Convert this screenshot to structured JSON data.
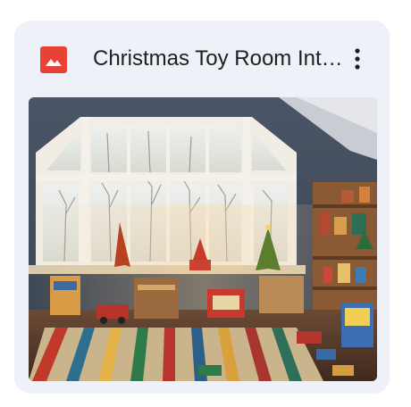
{
  "file": {
    "title": "Christmas Toy Room Interior.jpg",
    "type_icon": "image-file-icon",
    "type_icon_color": "#e94235"
  },
  "menu": {
    "icon": "more-vertical-icon"
  },
  "thumbnail": {
    "subject": "christmas-toy-room-photo"
  }
}
